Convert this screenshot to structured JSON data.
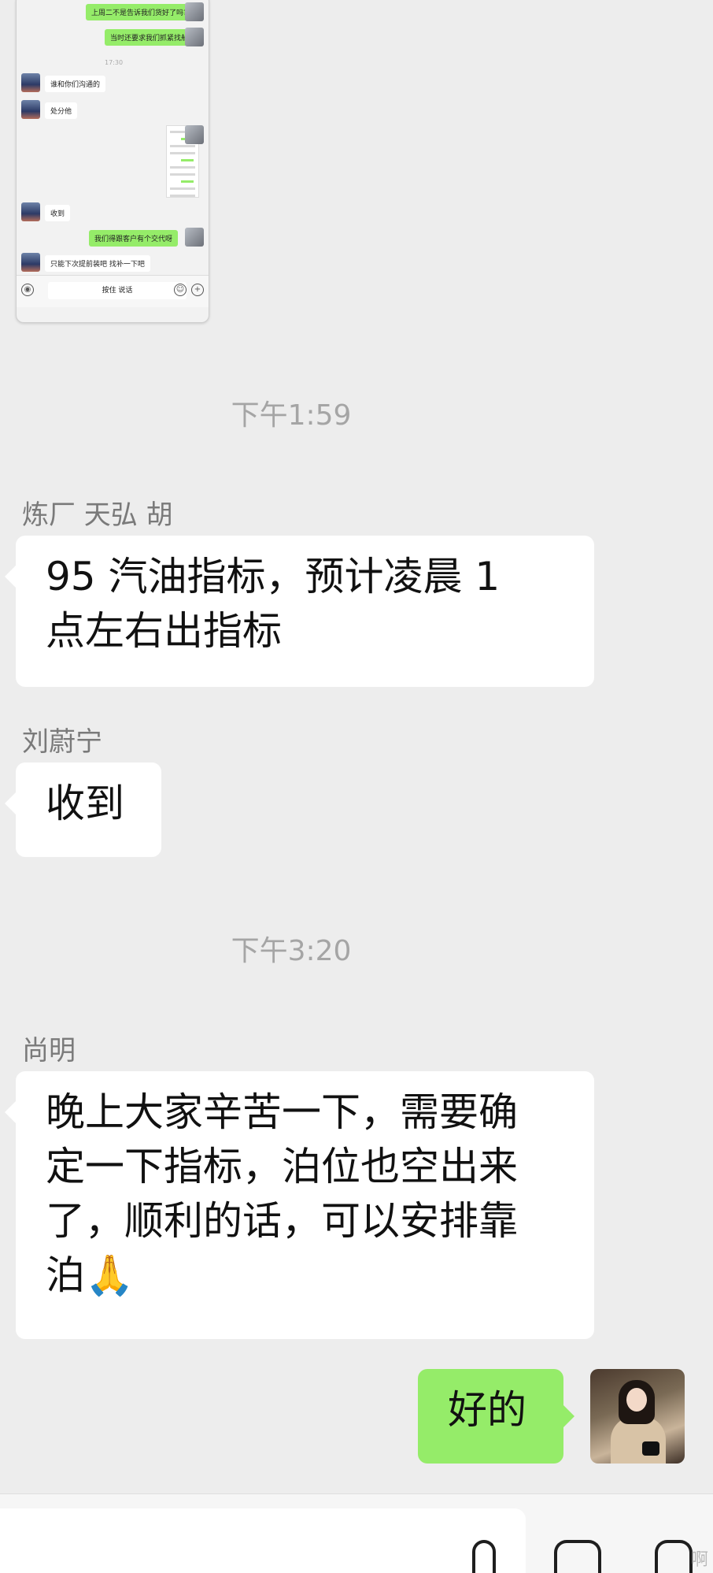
{
  "embedded_screenshot": {
    "messages": [
      {
        "side": "out",
        "text": "上周二不是告诉我们货好了吗?"
      },
      {
        "side": "out",
        "text": "当时还要求我们抓紧找船"
      },
      {
        "side": "in",
        "text": "谁和你们沟通的"
      },
      {
        "side": "in",
        "text": "处分他"
      },
      {
        "side": "in",
        "text": "收到"
      },
      {
        "side": "out",
        "text": "我们得跟客户有个交代呀"
      },
      {
        "side": "in",
        "text": "只能下次提前装吧  找补一下吧"
      }
    ],
    "time": "17:30",
    "hold_to_talk": "按住 说话"
  },
  "chat": {
    "time_1": "下午1:59",
    "msg_1": {
      "sender": "炼厂 天弘 胡",
      "line1": "95 汽油指标，预计凌晨 1",
      "line2": "点左右出指标"
    },
    "msg_2": {
      "sender": "刘蔚宁",
      "text": "收到"
    },
    "time_2": "下午3:20",
    "msg_3": {
      "sender": "尚明",
      "line1": "晚上大家辛苦一下，需要确",
      "line2": "定一下指标，泊位也空出来",
      "line3": "了，顺利的话，可以安排靠",
      "line4": "泊",
      "emoji": "🙏"
    },
    "msg_4": {
      "text": "好的"
    }
  },
  "watermark": "啊"
}
